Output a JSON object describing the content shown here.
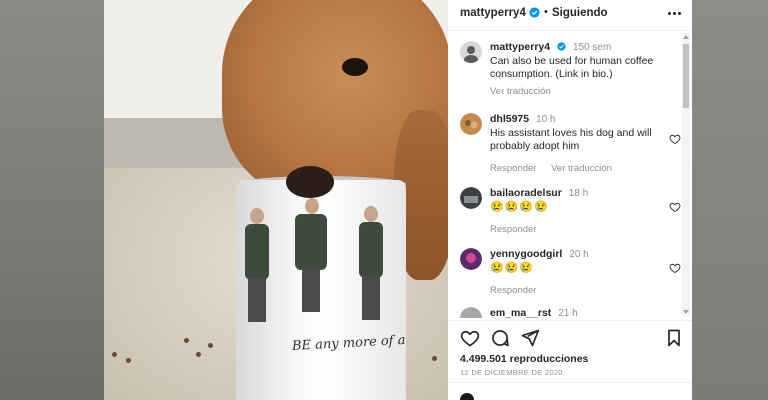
{
  "post": {
    "author": "mattyperry4",
    "follow_status": "Siguiendo",
    "views": "4.499.501 reproducciones",
    "date": "12 DE DICIEMBRE DE 2020",
    "mug_text": "BE any more of a"
  },
  "caption": {
    "user": "mattyperry4",
    "time": "150 sem",
    "text": "Can also be used for human coffee consumption. (Link in bio.)",
    "translate": "Ver traducción"
  },
  "comments": [
    {
      "user": "dhl5975",
      "time": "10 h",
      "text": "His assistant loves his dog and will probably adopt him",
      "reply": "Responder",
      "translate": "Ver traducción"
    },
    {
      "user": "bailaoradelsur",
      "time": "18 h",
      "text": "😢😢😢😢",
      "reply": "Responder"
    },
    {
      "user": "yennygoodgirl",
      "time": "20 h",
      "text": "😢😢😢",
      "reply": "Responder"
    },
    {
      "user": "em_ma__rst",
      "time": "21 h"
    }
  ],
  "colors": {
    "verified_blue": "#0095f6",
    "text_primary": "#262626",
    "text_secondary": "#8e8e8e"
  },
  "icons": [
    "more-icon",
    "verified-icon",
    "heart-icon",
    "like-icon",
    "comment-icon",
    "share-icon",
    "save-icon"
  ]
}
